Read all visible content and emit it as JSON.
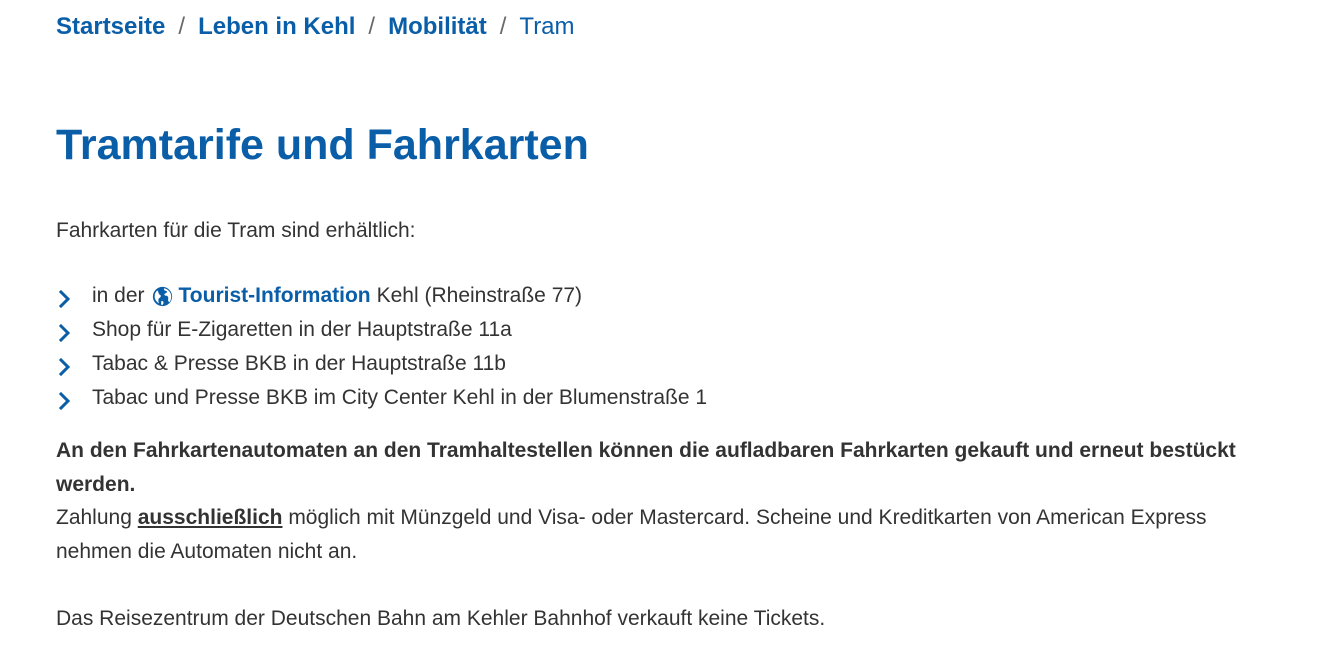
{
  "breadcrumb": {
    "items": [
      "Startseite",
      "Leben in Kehl",
      "Mobilität"
    ],
    "separator": "/",
    "current": "Tram"
  },
  "page": {
    "title": "Tramtarife und Fahrkarten",
    "intro": "Fahrkarten für die Tram sind erhältlich:"
  },
  "stores": {
    "first_prefix": "in der",
    "first_link": "Tourist-Information",
    "first_suffix": "Kehl (Rheinstraße 77)",
    "items": [
      "Shop für E-Zigaretten in der Hauptstraße 11a",
      "Tabac & Presse BKB in der Hauptstraße 11b",
      "Tabac und Presse BKB im City Center Kehl in der Blumenstraße 1"
    ]
  },
  "machines": {
    "bold_text": "An den Fahrkartenautomaten an den Tramhaltestellen können die aufladbaren Fahrkarten gekauft und erneut bestückt werden.",
    "payment_prefix": "Zahlung",
    "payment_emphasis": "ausschließlich",
    "payment_suffix": "möglich mit Münzgeld und Visa- oder Mastercard. Scheine und Kreditkarten von American Express nehmen die Automaten nicht an."
  },
  "note": "Das Reisezentrum der Deutschen Bahn am Kehler Bahnhof verkauft keine Tickets.",
  "icons": {
    "list_bullet": "chevron-right-icon",
    "external": "globe-icon"
  },
  "colors": {
    "accent": "#0a5ea8",
    "text": "#333333"
  }
}
